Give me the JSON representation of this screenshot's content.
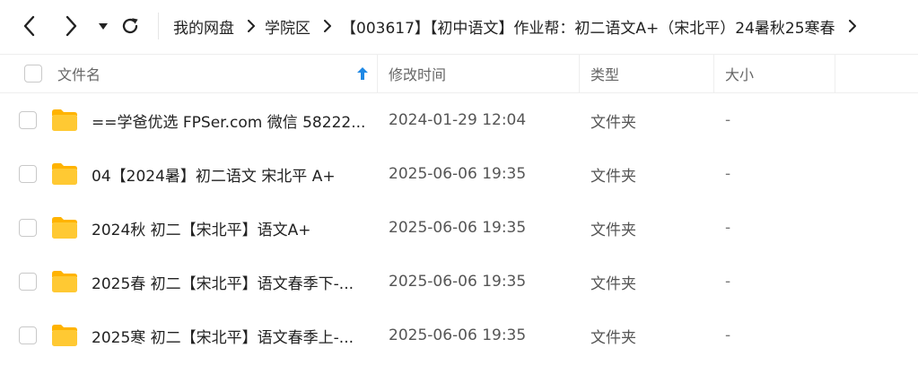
{
  "toolbar": {
    "back_icon": "chevron-left-icon",
    "forward_icon": "chevron-right-icon",
    "history_dropdown_icon": "caret-down-icon",
    "refresh_icon": "refresh-icon"
  },
  "breadcrumb": {
    "items": [
      "我的网盘",
      "学院区",
      "【003617】【初中语文】作业帮：初二语文A+（宋北平）24暑秋25寒春"
    ],
    "separator_icon": "chevron-right-icon"
  },
  "table": {
    "columns": {
      "name": "文件名",
      "modified": "修改时间",
      "type": "类型",
      "size": "大小"
    },
    "sort_icon": "sort-arrow-up-icon",
    "rows": [
      {
        "name": "==学爸优选 FPSer.com 微信 58222...",
        "modified": "2024-01-29 12:04",
        "type": "文件夹",
        "size": "-"
      },
      {
        "name": "04【2024暑】初二语文 宋北平 A+",
        "modified": "2025-06-06 19:35",
        "type": "文件夹",
        "size": "-"
      },
      {
        "name": "2024秋 初二【宋北平】语文A+",
        "modified": "2025-06-06 19:35",
        "type": "文件夹",
        "size": "-"
      },
      {
        "name": "2025春 初二【宋北平】语文春季下-...",
        "modified": "2025-06-06 19:35",
        "type": "文件夹",
        "size": "-"
      },
      {
        "name": "2025寒 初二【宋北平】语文春季上-...",
        "modified": "2025-06-06 19:35",
        "type": "文件夹",
        "size": "-"
      }
    ]
  },
  "colors": {
    "folder": "#FFC933",
    "folder_back": "#FFB300",
    "accent": "#1E88E5"
  }
}
